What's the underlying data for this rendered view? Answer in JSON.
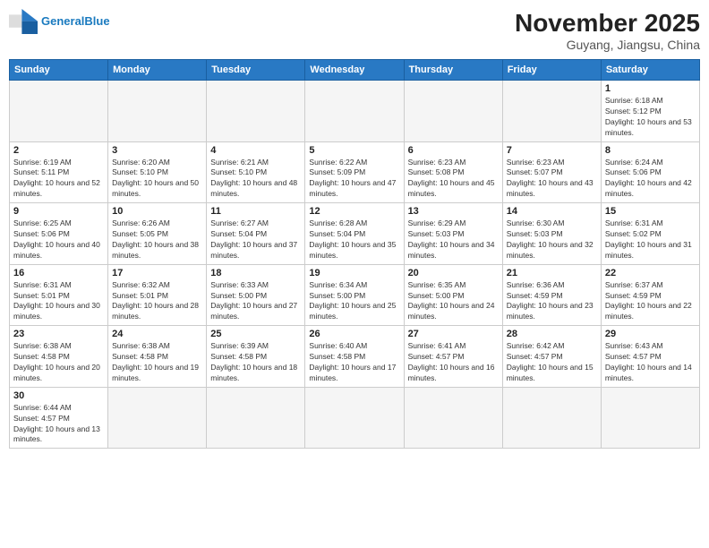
{
  "header": {
    "logo_general": "General",
    "logo_blue": "Blue",
    "month_year": "November 2025",
    "location": "Guyang, Jiangsu, China"
  },
  "weekdays": [
    "Sunday",
    "Monday",
    "Tuesday",
    "Wednesday",
    "Thursday",
    "Friday",
    "Saturday"
  ],
  "days": [
    {
      "num": "",
      "sunrise": "",
      "sunset": "",
      "daylight": "",
      "empty": true
    },
    {
      "num": "",
      "sunrise": "",
      "sunset": "",
      "daylight": "",
      "empty": true
    },
    {
      "num": "",
      "sunrise": "",
      "sunset": "",
      "daylight": "",
      "empty": true
    },
    {
      "num": "",
      "sunrise": "",
      "sunset": "",
      "daylight": "",
      "empty": true
    },
    {
      "num": "",
      "sunrise": "",
      "sunset": "",
      "daylight": "",
      "empty": true
    },
    {
      "num": "",
      "sunrise": "",
      "sunset": "",
      "daylight": "",
      "empty": true
    },
    {
      "num": "1",
      "sunrise": "Sunrise: 6:18 AM",
      "sunset": "Sunset: 5:12 PM",
      "daylight": "Daylight: 10 hours and 53 minutes.",
      "empty": false
    },
    {
      "num": "2",
      "sunrise": "Sunrise: 6:19 AM",
      "sunset": "Sunset: 5:11 PM",
      "daylight": "Daylight: 10 hours and 52 minutes.",
      "empty": false
    },
    {
      "num": "3",
      "sunrise": "Sunrise: 6:20 AM",
      "sunset": "Sunset: 5:10 PM",
      "daylight": "Daylight: 10 hours and 50 minutes.",
      "empty": false
    },
    {
      "num": "4",
      "sunrise": "Sunrise: 6:21 AM",
      "sunset": "Sunset: 5:10 PM",
      "daylight": "Daylight: 10 hours and 48 minutes.",
      "empty": false
    },
    {
      "num": "5",
      "sunrise": "Sunrise: 6:22 AM",
      "sunset": "Sunset: 5:09 PM",
      "daylight": "Daylight: 10 hours and 47 minutes.",
      "empty": false
    },
    {
      "num": "6",
      "sunrise": "Sunrise: 6:23 AM",
      "sunset": "Sunset: 5:08 PM",
      "daylight": "Daylight: 10 hours and 45 minutes.",
      "empty": false
    },
    {
      "num": "7",
      "sunrise": "Sunrise: 6:23 AM",
      "sunset": "Sunset: 5:07 PM",
      "daylight": "Daylight: 10 hours and 43 minutes.",
      "empty": false
    },
    {
      "num": "8",
      "sunrise": "Sunrise: 6:24 AM",
      "sunset": "Sunset: 5:06 PM",
      "daylight": "Daylight: 10 hours and 42 minutes.",
      "empty": false
    },
    {
      "num": "9",
      "sunrise": "Sunrise: 6:25 AM",
      "sunset": "Sunset: 5:06 PM",
      "daylight": "Daylight: 10 hours and 40 minutes.",
      "empty": false
    },
    {
      "num": "10",
      "sunrise": "Sunrise: 6:26 AM",
      "sunset": "Sunset: 5:05 PM",
      "daylight": "Daylight: 10 hours and 38 minutes.",
      "empty": false
    },
    {
      "num": "11",
      "sunrise": "Sunrise: 6:27 AM",
      "sunset": "Sunset: 5:04 PM",
      "daylight": "Daylight: 10 hours and 37 minutes.",
      "empty": false
    },
    {
      "num": "12",
      "sunrise": "Sunrise: 6:28 AM",
      "sunset": "Sunset: 5:04 PM",
      "daylight": "Daylight: 10 hours and 35 minutes.",
      "empty": false
    },
    {
      "num": "13",
      "sunrise": "Sunrise: 6:29 AM",
      "sunset": "Sunset: 5:03 PM",
      "daylight": "Daylight: 10 hours and 34 minutes.",
      "empty": false
    },
    {
      "num": "14",
      "sunrise": "Sunrise: 6:30 AM",
      "sunset": "Sunset: 5:03 PM",
      "daylight": "Daylight: 10 hours and 32 minutes.",
      "empty": false
    },
    {
      "num": "15",
      "sunrise": "Sunrise: 6:31 AM",
      "sunset": "Sunset: 5:02 PM",
      "daylight": "Daylight: 10 hours and 31 minutes.",
      "empty": false
    },
    {
      "num": "16",
      "sunrise": "Sunrise: 6:31 AM",
      "sunset": "Sunset: 5:01 PM",
      "daylight": "Daylight: 10 hours and 30 minutes.",
      "empty": false
    },
    {
      "num": "17",
      "sunrise": "Sunrise: 6:32 AM",
      "sunset": "Sunset: 5:01 PM",
      "daylight": "Daylight: 10 hours and 28 minutes.",
      "empty": false
    },
    {
      "num": "18",
      "sunrise": "Sunrise: 6:33 AM",
      "sunset": "Sunset: 5:00 PM",
      "daylight": "Daylight: 10 hours and 27 minutes.",
      "empty": false
    },
    {
      "num": "19",
      "sunrise": "Sunrise: 6:34 AM",
      "sunset": "Sunset: 5:00 PM",
      "daylight": "Daylight: 10 hours and 25 minutes.",
      "empty": false
    },
    {
      "num": "20",
      "sunrise": "Sunrise: 6:35 AM",
      "sunset": "Sunset: 5:00 PM",
      "daylight": "Daylight: 10 hours and 24 minutes.",
      "empty": false
    },
    {
      "num": "21",
      "sunrise": "Sunrise: 6:36 AM",
      "sunset": "Sunset: 4:59 PM",
      "daylight": "Daylight: 10 hours and 23 minutes.",
      "empty": false
    },
    {
      "num": "22",
      "sunrise": "Sunrise: 6:37 AM",
      "sunset": "Sunset: 4:59 PM",
      "daylight": "Daylight: 10 hours and 22 minutes.",
      "empty": false
    },
    {
      "num": "23",
      "sunrise": "Sunrise: 6:38 AM",
      "sunset": "Sunset: 4:58 PM",
      "daylight": "Daylight: 10 hours and 20 minutes.",
      "empty": false
    },
    {
      "num": "24",
      "sunrise": "Sunrise: 6:38 AM",
      "sunset": "Sunset: 4:58 PM",
      "daylight": "Daylight: 10 hours and 19 minutes.",
      "empty": false
    },
    {
      "num": "25",
      "sunrise": "Sunrise: 6:39 AM",
      "sunset": "Sunset: 4:58 PM",
      "daylight": "Daylight: 10 hours and 18 minutes.",
      "empty": false
    },
    {
      "num": "26",
      "sunrise": "Sunrise: 6:40 AM",
      "sunset": "Sunset: 4:58 PM",
      "daylight": "Daylight: 10 hours and 17 minutes.",
      "empty": false
    },
    {
      "num": "27",
      "sunrise": "Sunrise: 6:41 AM",
      "sunset": "Sunset: 4:57 PM",
      "daylight": "Daylight: 10 hours and 16 minutes.",
      "empty": false
    },
    {
      "num": "28",
      "sunrise": "Sunrise: 6:42 AM",
      "sunset": "Sunset: 4:57 PM",
      "daylight": "Daylight: 10 hours and 15 minutes.",
      "empty": false
    },
    {
      "num": "29",
      "sunrise": "Sunrise: 6:43 AM",
      "sunset": "Sunset: 4:57 PM",
      "daylight": "Daylight: 10 hours and 14 minutes.",
      "empty": false
    },
    {
      "num": "30",
      "sunrise": "Sunrise: 6:44 AM",
      "sunset": "Sunset: 4:57 PM",
      "daylight": "Daylight: 10 hours and 13 minutes.",
      "empty": false
    }
  ]
}
